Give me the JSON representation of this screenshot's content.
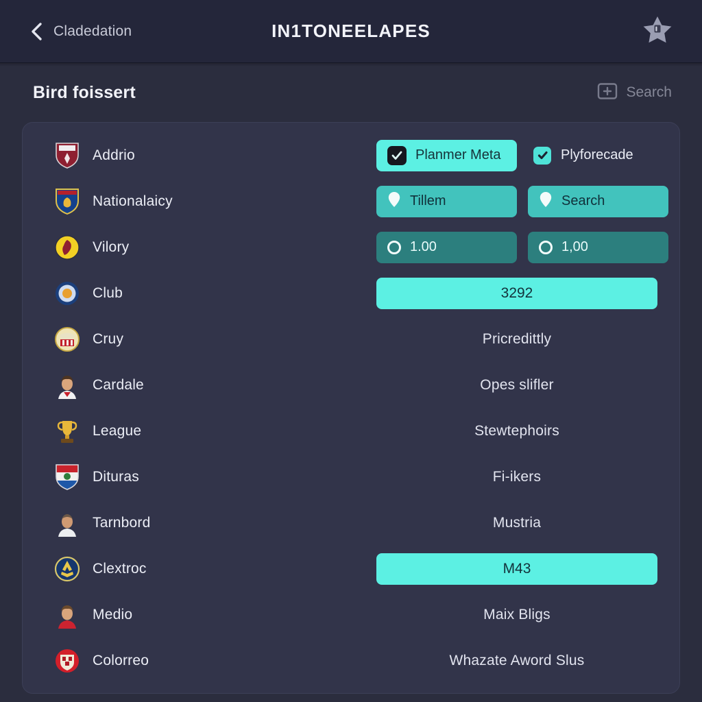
{
  "appbar": {
    "back_icon": "chevron-left-icon",
    "back_label": "Cladedation",
    "title": "IN1TONEELAPES",
    "star_icon": "star-badge-icon"
  },
  "section": {
    "title": "Bird foissert",
    "add_icon": "add-box-icon",
    "search_label": "Search"
  },
  "rows": [
    {
      "label": "Addrio",
      "emblem": "crest-dark-red-shield-icon",
      "right_type": "controls",
      "controls": [
        {
          "kind": "pill-bright",
          "icon": "checkbox-checked-icon",
          "label": "Planmer Meta"
        },
        {
          "kind": "bare-check",
          "icon": "checkbox-cyan-icon",
          "label": "Plyforecade"
        }
      ]
    },
    {
      "label": "Nationalaicy",
      "emblem": "crest-blue-gold-shield-icon",
      "right_type": "controls",
      "controls": [
        {
          "kind": "pill-mid",
          "icon": "location-pin-icon",
          "label": "Tillem"
        },
        {
          "kind": "pill-mid",
          "icon": "location-pin-icon",
          "label": "Search"
        }
      ]
    },
    {
      "label": "Vilory",
      "emblem": "crest-yellow-circle-icon",
      "right_type": "controls",
      "controls": [
        {
          "kind": "pill-dark",
          "icon": "radio-unchecked-icon",
          "label": "1.00"
        },
        {
          "kind": "pill-dark",
          "icon": "radio-unchecked-icon",
          "label": "1,00"
        }
      ]
    },
    {
      "label": "Club",
      "emblem": "crest-blue-circle-icon",
      "right_type": "wide-button",
      "button": {
        "kind": "pill-bright",
        "label": "3292"
      }
    },
    {
      "label": "Cruy",
      "emblem": "crest-gold-circle-icon",
      "right_type": "text",
      "text": "Pricredittly"
    },
    {
      "label": "Cardale",
      "emblem": "player-photo-white-kit-icon",
      "right_type": "text",
      "text": "Opes slifler"
    },
    {
      "label": "League",
      "emblem": "trophy-gold-icon",
      "right_type": "text",
      "text": "Stewtephoirs"
    },
    {
      "label": "Dituras",
      "emblem": "crest-red-white-blue-shield-icon",
      "right_type": "text",
      "text": "Fi-ikers"
    },
    {
      "label": "Tarnbord",
      "emblem": "player-photo-bald-icon",
      "right_type": "text",
      "text": "Mustria"
    },
    {
      "label": "Clextroc",
      "emblem": "crest-navy-gold-circle-icon",
      "right_type": "wide-button",
      "button": {
        "kind": "pill-bright",
        "label": "M43"
      }
    },
    {
      "label": "Medio",
      "emblem": "player-photo-red-kit-icon",
      "right_type": "text",
      "text": "Maix Bligs"
    },
    {
      "label": "Colorreo",
      "emblem": "crest-red-circle-icon",
      "right_type": "text",
      "text": "Whazate Aword Slus"
    }
  ],
  "colors": {
    "page_bg": "#2b2d3e",
    "appbar_bg": "#24263a",
    "panel_bg": "#32344a",
    "accent_bright": "#5cf0e3",
    "accent_mid": "#42c3bd",
    "accent_dark": "#2c7f7e",
    "text_primary": "#eceef6",
    "text_muted": "#c9cbd8"
  }
}
